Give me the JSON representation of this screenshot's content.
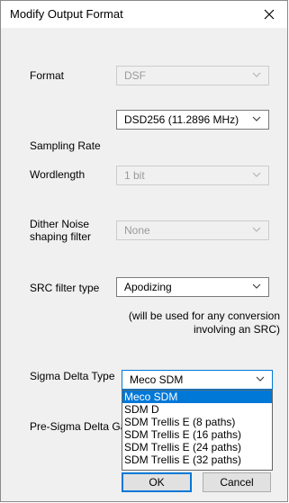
{
  "window": {
    "title": "Modify Output Format"
  },
  "fields": {
    "format": {
      "label": "Format",
      "value": "DSF"
    },
    "sampling_rate": {
      "label": "Sampling Rate",
      "value": "DSD256 (11.2896 MHz)"
    },
    "wordlength": {
      "label": "Wordlength",
      "value": "1 bit"
    },
    "dither": {
      "label_line1": "Dither Noise",
      "label_line2": "shaping filter",
      "value": "None"
    },
    "src_filter": {
      "label": "SRC filter type",
      "value": "Apodizing"
    },
    "src_note_line1": "(will be used for any conversion",
    "src_note_line2": "involving an SRC)",
    "sigma_delta": {
      "label": "Sigma Delta Type",
      "value": "Meco SDM"
    },
    "pre_sigma_gain": {
      "label": "Pre-Sigma Delta Ga"
    }
  },
  "dropdown": {
    "options": [
      "Meco SDM",
      "SDM D",
      "SDM Trellis E (8 paths)",
      "SDM Trellis E (16 paths)",
      "SDM Trellis E (24 paths)",
      "SDM Trellis E (32 paths)"
    ],
    "selected_index": 0
  },
  "buttons": {
    "ok": "OK",
    "cancel": "Cancel"
  },
  "icons": {
    "close": "close-icon",
    "arrow": "chevron-down-icon"
  },
  "colors": {
    "accent": "#0078d7"
  }
}
